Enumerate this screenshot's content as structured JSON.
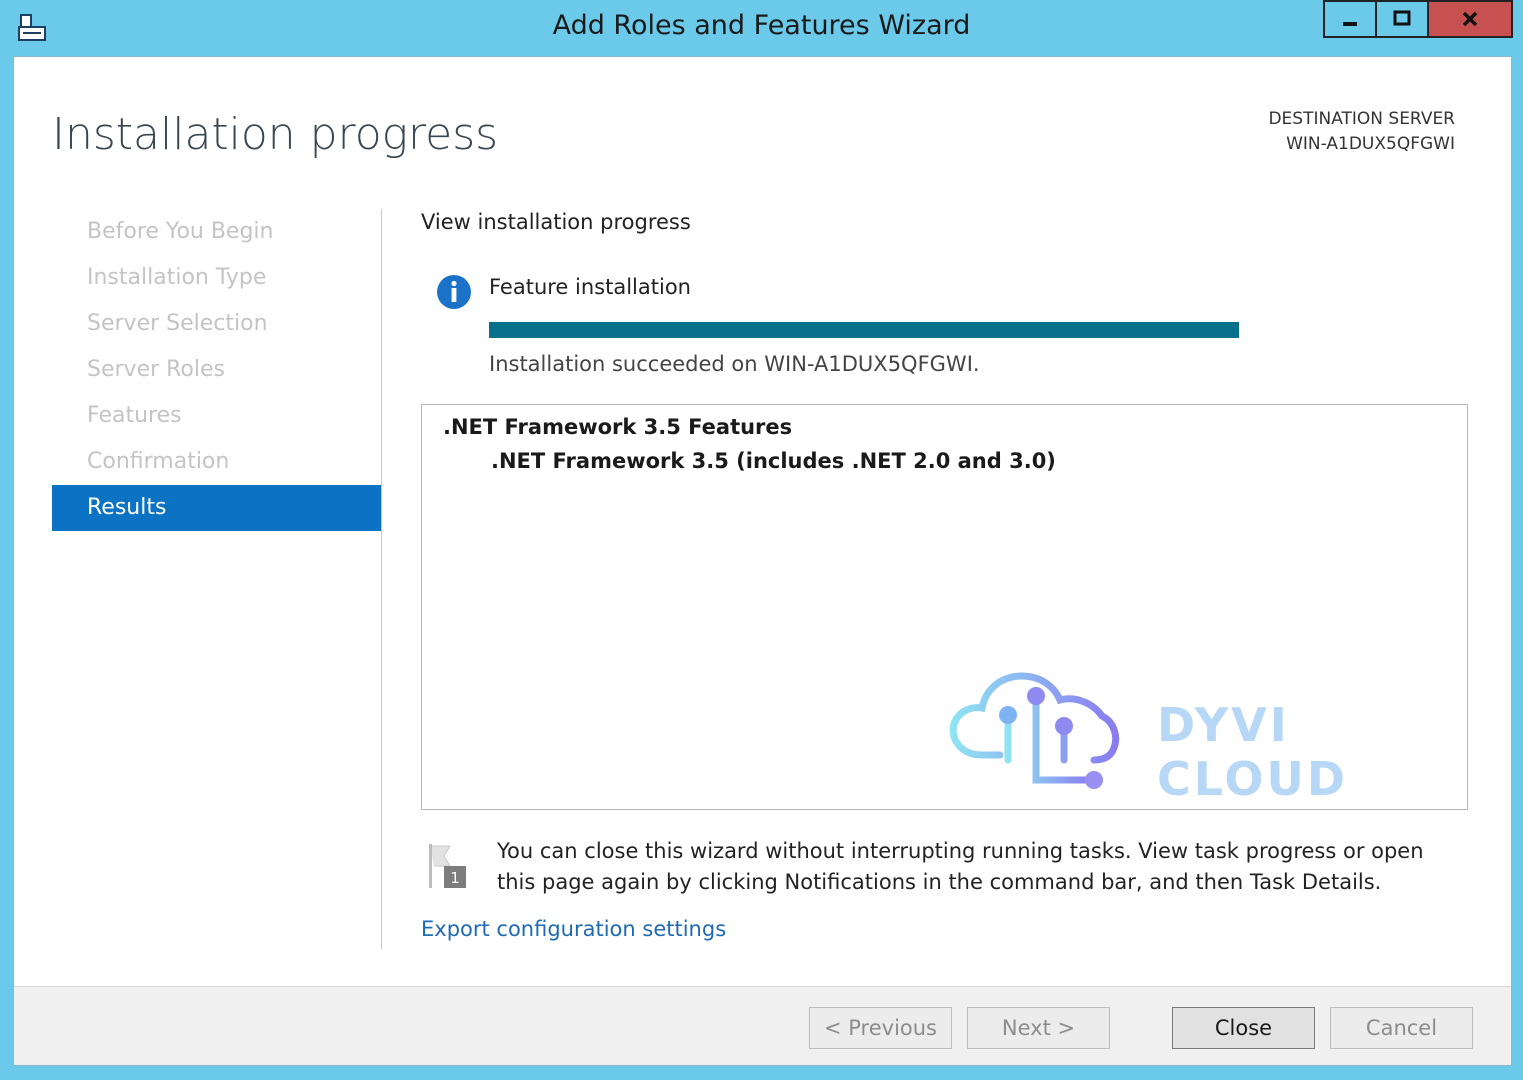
{
  "window": {
    "title": "Add Roles and Features Wizard",
    "icon": "server-manager-icon"
  },
  "header": {
    "page_title": "Installation progress",
    "destination_label": "DESTINATION SERVER",
    "destination_server": "WIN-A1DUX5QFGWI"
  },
  "nav": {
    "items": [
      {
        "label": "Before You Begin"
      },
      {
        "label": "Installation Type"
      },
      {
        "label": "Server Selection"
      },
      {
        "label": "Server Roles"
      },
      {
        "label": "Features"
      },
      {
        "label": "Confirmation"
      },
      {
        "label": "Results"
      }
    ],
    "active_item": "Results"
  },
  "main": {
    "subheading": "View installation progress",
    "feature_heading": "Feature installation",
    "progress_percent": 100,
    "status": "Installation succeeded on WIN-A1DUX5QFGWI.",
    "results": {
      "parent": ".NET Framework 3.5 Features",
      "child": ".NET Framework 3.5 (includes .NET 2.0 and 3.0)"
    },
    "watermark": "DYVI CLOUD",
    "note": "You can close this wizard without interrupting running tasks. View task progress or open this page again by clicking Notifications in the command bar, and then Task Details.",
    "export_link": "Export configuration settings"
  },
  "footer": {
    "previous": "< Previous",
    "next": "Next >",
    "close": "Close",
    "cancel": "Cancel"
  },
  "colors": {
    "titlebar": "#6bc9ea",
    "nav_active": "#0b72c4",
    "progress": "#07718c",
    "link": "#1e6ab5",
    "close_button": "#c75050"
  }
}
